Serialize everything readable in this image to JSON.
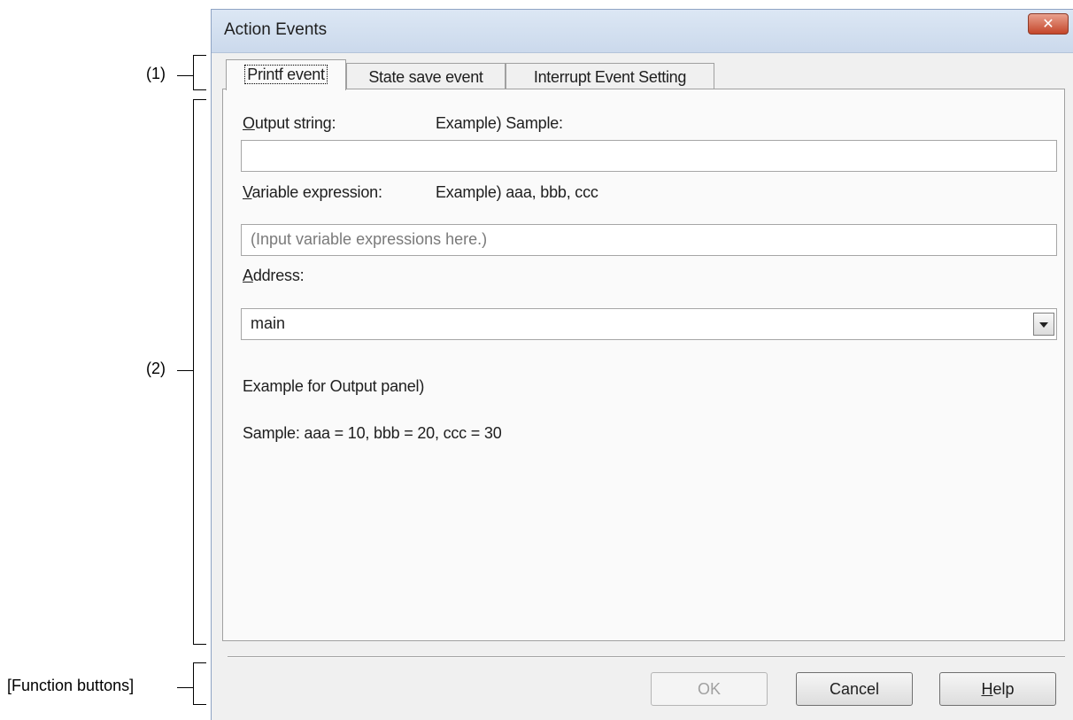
{
  "callouts": {
    "c1": "(1)",
    "c2": "(2)",
    "fb": "[Function buttons]"
  },
  "window": {
    "title": "Action Events",
    "close_glyph": "✕"
  },
  "tabs": [
    {
      "label": "Printf event",
      "active": true
    },
    {
      "label": "State save event",
      "active": false
    },
    {
      "label": "Interrupt Event Setting",
      "active": false
    }
  ],
  "printf": {
    "output_label_key": "O",
    "output_label_rest": "utput string:",
    "output_example": "Example) Sample:",
    "output_value": "",
    "variable_label_key": "V",
    "variable_label_rest": "ariable expression:",
    "variable_example": "Example) aaa, bbb, ccc",
    "variable_placeholder": "(Input variable expressions here.)",
    "address_label_key": "A",
    "address_label_rest": "ddress:",
    "address_value": "main",
    "example_heading": "Example for Output panel)",
    "example_text": "Sample: aaa = 10, bbb = 20, ccc = 30"
  },
  "buttons": {
    "ok": "OK",
    "cancel": "Cancel",
    "help_key": "H",
    "help_rest": "elp"
  },
  "icons": {
    "close": "close-icon",
    "dropdown": "chevron-down-icon"
  }
}
